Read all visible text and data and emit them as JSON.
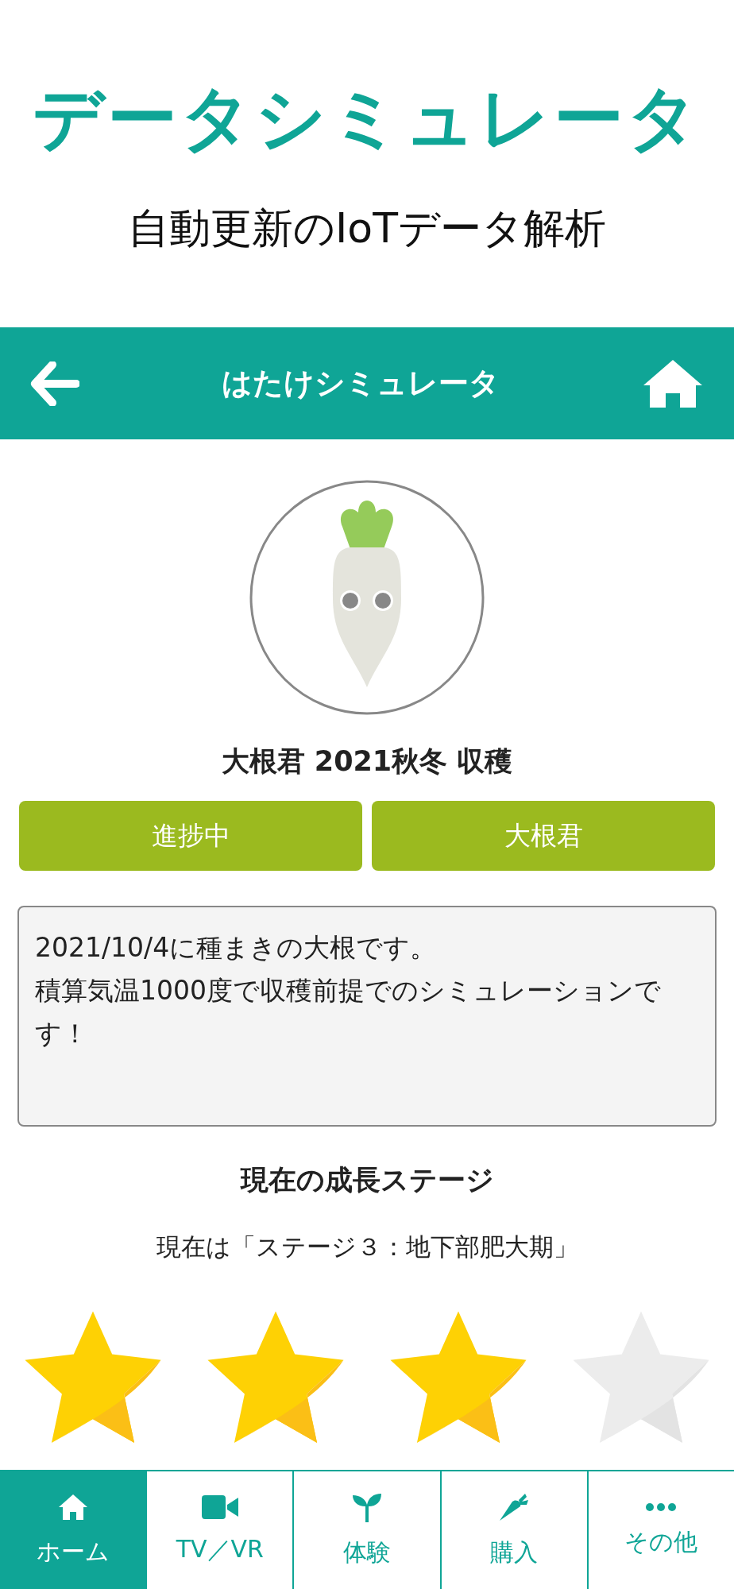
{
  "promo": {
    "title": "データシミュレータ",
    "subtitle": "自動更新のIoTデータ解析"
  },
  "header": {
    "title": "はたけシミュレータ"
  },
  "crop": {
    "name": "大根君 2021秋冬 収穫",
    "tags": [
      "進捗中",
      "大根君"
    ],
    "description": [
      "2021/10/4に種まきの大根です。",
      "積算気温1000度で収穫前提でのシミュレーションです！"
    ]
  },
  "stage": {
    "heading": "現在の成長ステージ",
    "current": "現在は「ステージ３：地下部肥大期」",
    "stars": 3
  },
  "bottom_nav": [
    {
      "label": "ホーム",
      "kind": "home",
      "selected": true
    },
    {
      "label": "TV／VR",
      "kind": "video",
      "selected": false
    },
    {
      "label": "体験",
      "kind": "sprout",
      "selected": false
    },
    {
      "label": "購入",
      "kind": "carrot",
      "selected": false
    },
    {
      "label": "その他",
      "kind": "more",
      "selected": false
    }
  ]
}
